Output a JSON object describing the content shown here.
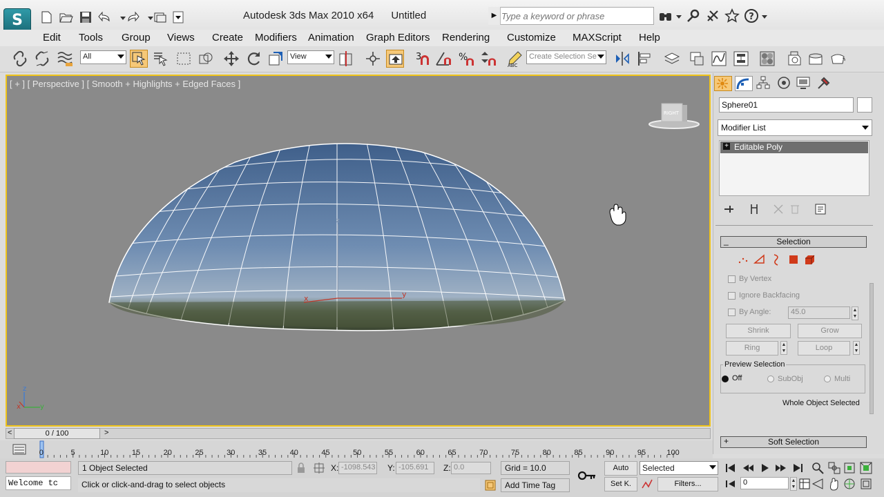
{
  "window": {
    "title": "Autodesk 3ds Max  2010 x64",
    "document": "Untitled"
  },
  "search": {
    "placeholder": "Type a keyword or phrase"
  },
  "menu": [
    "Edit",
    "Tools",
    "Group",
    "Views",
    "Create",
    "Modifiers",
    "Animation",
    "Graph Editors",
    "Rendering",
    "Customize",
    "MAXScript",
    "Help"
  ],
  "toolbar": {
    "selection_filter": "All",
    "ref_coord": "View",
    "named_selection": "Create Selection Se"
  },
  "viewport": {
    "label": "[ + ] [ Perspective ] [ Smooth + Highlights + Edged Faces ]",
    "viewcube_face": "RIGHT",
    "axis_x": "x",
    "axis_y": "y",
    "axis_z": "z"
  },
  "command_panel": {
    "object_name": "Sphere01",
    "modifier_list": "Modifier List",
    "stack_item": "Editable Poly",
    "selection_rollout": "Selection",
    "by_vertex": "By Vertex",
    "ignore_backfacing": "Ignore Backfacing",
    "by_angle": "By Angle:",
    "angle_value": "45.0",
    "shrink": "Shrink",
    "grow": "Grow",
    "ring": "Ring",
    "loop": "Loop",
    "preview_selection": "Preview Selection",
    "preview_off": "Off",
    "preview_subobj": "SubObj",
    "preview_multi": "Multi",
    "selection_status": "Whole Object Selected",
    "soft_selection_rollout": "Soft Selection"
  },
  "timeline": {
    "frame_display": "0 / 100",
    "ticks": [
      "0",
      "5",
      "10",
      "15",
      "20",
      "25",
      "30",
      "35",
      "40",
      "45",
      "50",
      "55",
      "60",
      "65",
      "70",
      "75",
      "80",
      "85",
      "90",
      "95",
      "100"
    ]
  },
  "status": {
    "maxscript_listener": "Welcome tc",
    "selection_count": "1 Object Selected",
    "prompt": "Click or click-and-drag to select objects",
    "x_label": "X:",
    "x_value": "-1098.543",
    "y_label": "Y:",
    "y_value": "-105.691",
    "z_label": "Z:",
    "z_value": "0.0",
    "grid": "Grid = 10.0",
    "add_time_tag": "Add Time Tag",
    "auto_key": "Auto",
    "set_key": "Set K.",
    "key_filter_mode": "Selected",
    "filters": "Filters...",
    "current_frame": "0"
  },
  "colors": {
    "viewport_bg": "#8a8a8a",
    "active_border": "#f0c419",
    "panel_bg": "#dadada",
    "stack_highlight": "#6f6f6f",
    "listener_bg": "#f2d2d2"
  }
}
